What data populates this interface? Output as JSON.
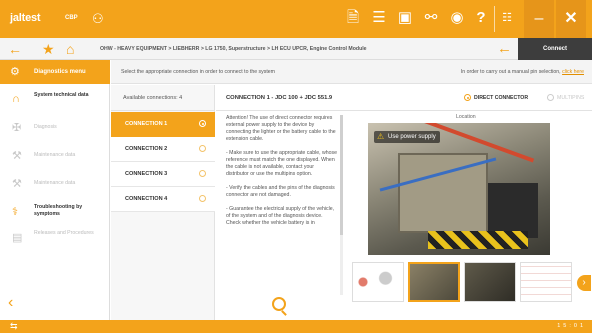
{
  "app": {
    "brand": "jaltest",
    "brand_sub": "CBP",
    "accent": "#f3a31b"
  },
  "topbar": {
    "icons": [
      "branch-icon",
      "document-icon",
      "list-icon",
      "truck-icon",
      "link-icon",
      "camera-icon",
      "help-icon",
      "grid-icon",
      "minimize-icon",
      "close-icon"
    ],
    "help_glyph": "?"
  },
  "breadcrumb": {
    "path": "OHW - HEAVY EQUIPMENT  >  LIEBHERR  >  LG 1750, Superstructure  >  LH ECU UPCR, Engine Control Module"
  },
  "connect_button": "Connect",
  "sidebar": {
    "header": "Diagnostics menu",
    "items": [
      {
        "label": "System technical data",
        "enabled": true
      },
      {
        "label": "Diagnosis",
        "enabled": false
      },
      {
        "label": "Maintenance data",
        "enabled": false
      },
      {
        "label": "Maintenance data",
        "enabled": false
      },
      {
        "label": "Troubleshooting by symptoms",
        "enabled": true
      },
      {
        "label": "Releases and Procedures",
        "enabled": false
      }
    ]
  },
  "instruction_bar": {
    "left": "Select the appropriate connection in order to connect to the system",
    "right_prefix": "In order to carry out a manual pin selection, ",
    "right_link": "click here"
  },
  "connections": {
    "header": "Available connections: 4",
    "items": [
      {
        "label": "CONNECTION 1",
        "selected": true
      },
      {
        "label": "CONNECTION 2",
        "selected": false
      },
      {
        "label": "CONNECTION 3",
        "selected": false
      },
      {
        "label": "CONNECTION 4",
        "selected": false
      }
    ]
  },
  "detail": {
    "title": "CONNECTION 1 - JDC 100 + JDC 551.9",
    "radio_direct": "DIRECT CONNECTOR",
    "radio_multi": "MULTIPINS",
    "location_label": "Location",
    "photo_badge": "Use power supply",
    "instructions": [
      "Attention! The use of direct connector requires external power supply to the device by connecting the lighter or the battery cable to the extension cable.",
      "- Make sure to use the appropriate cable, whose reference must match the one displayed. When the cable is not available, contact your distributor or use the multipins option.",
      "- Verify the cables and the pins of the diagnosis connector are not damaged.",
      "- Guarantee the electrical supply of the vehicle, of the system and of the diagnosis device. Check whether the vehicle battery is in"
    ],
    "selected_thumbnail": 2,
    "thumbnail_count": 4
  },
  "footer": {
    "status": "15:01"
  }
}
